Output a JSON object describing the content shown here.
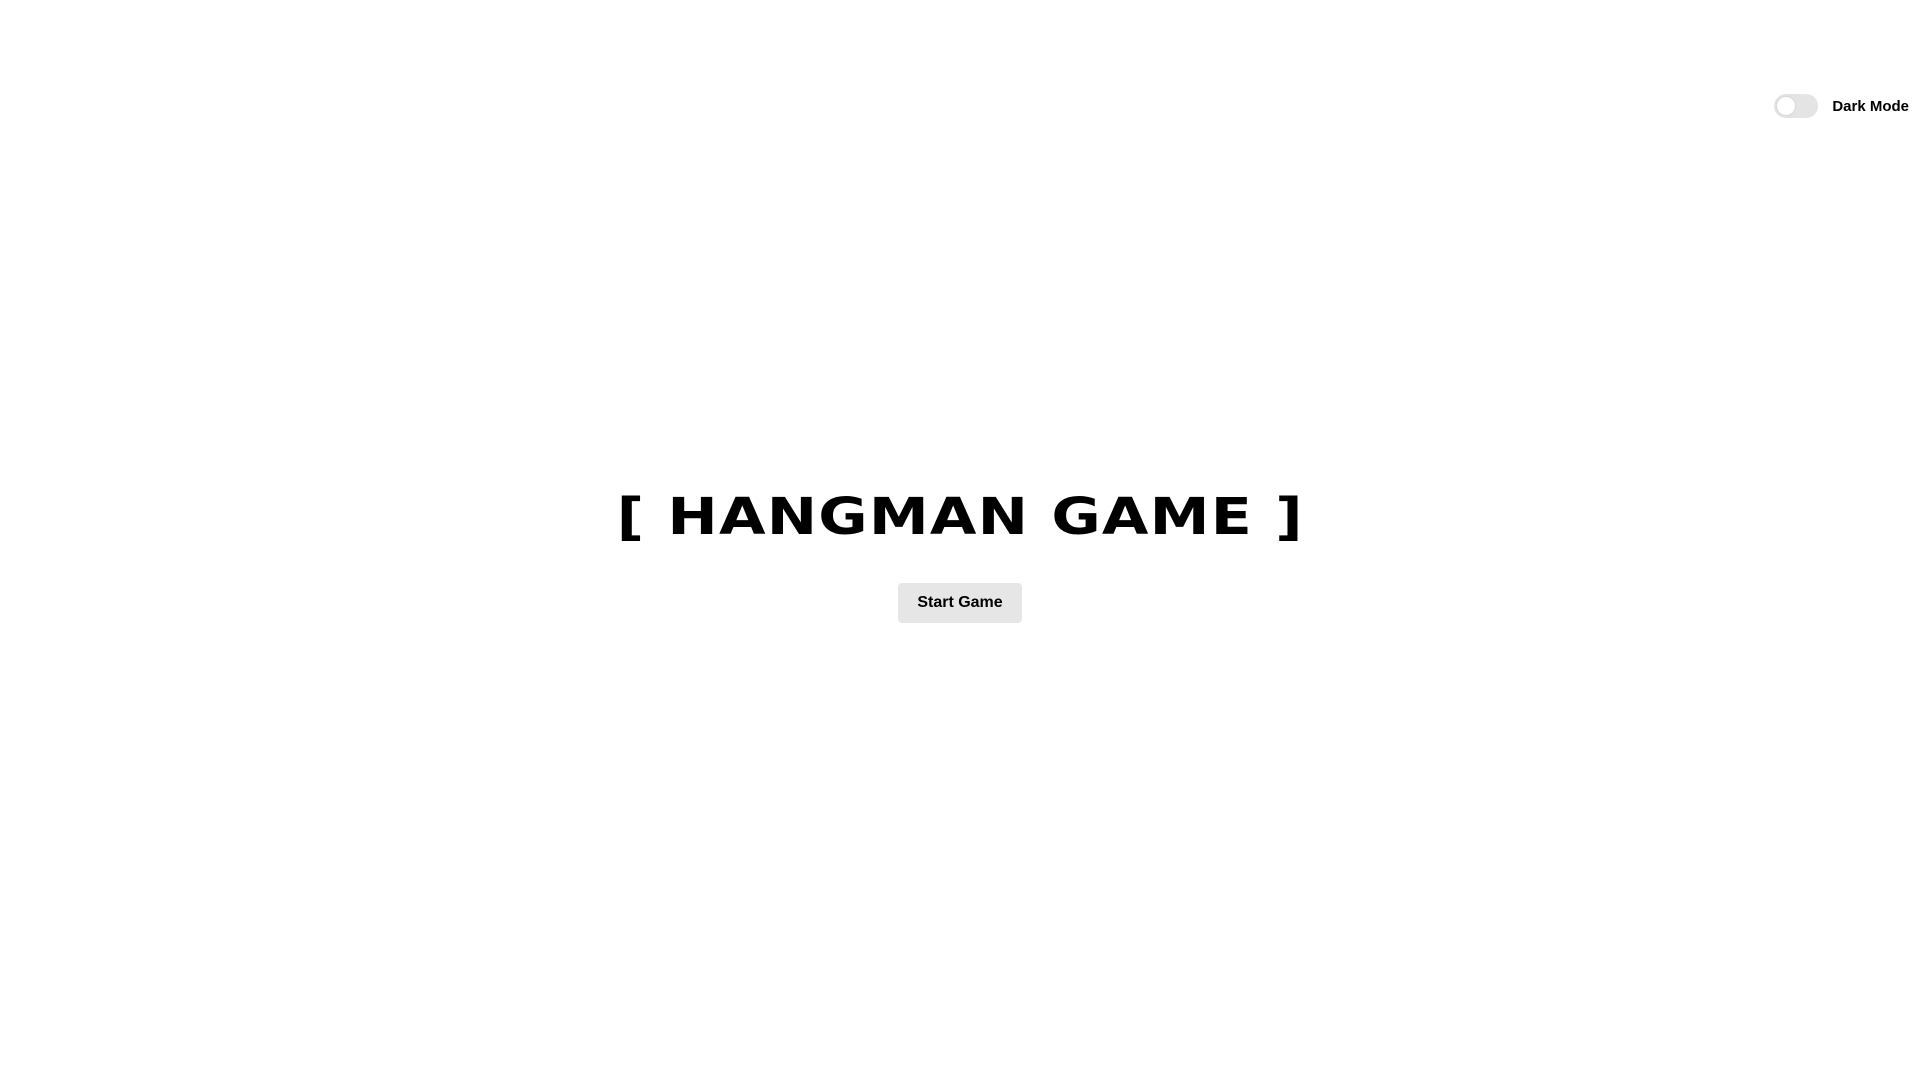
{
  "header": {
    "dark_mode_toggle": {
      "label": "Dark Mode",
      "enabled": false
    }
  },
  "main": {
    "title": "[ HANGMAN GAME ]",
    "start_button_label": "Start Game"
  },
  "colors": {
    "background": "#ffffff",
    "text": "#000000",
    "button_background": "#e6e6e6",
    "toggle_track": "#e4e4e4"
  }
}
